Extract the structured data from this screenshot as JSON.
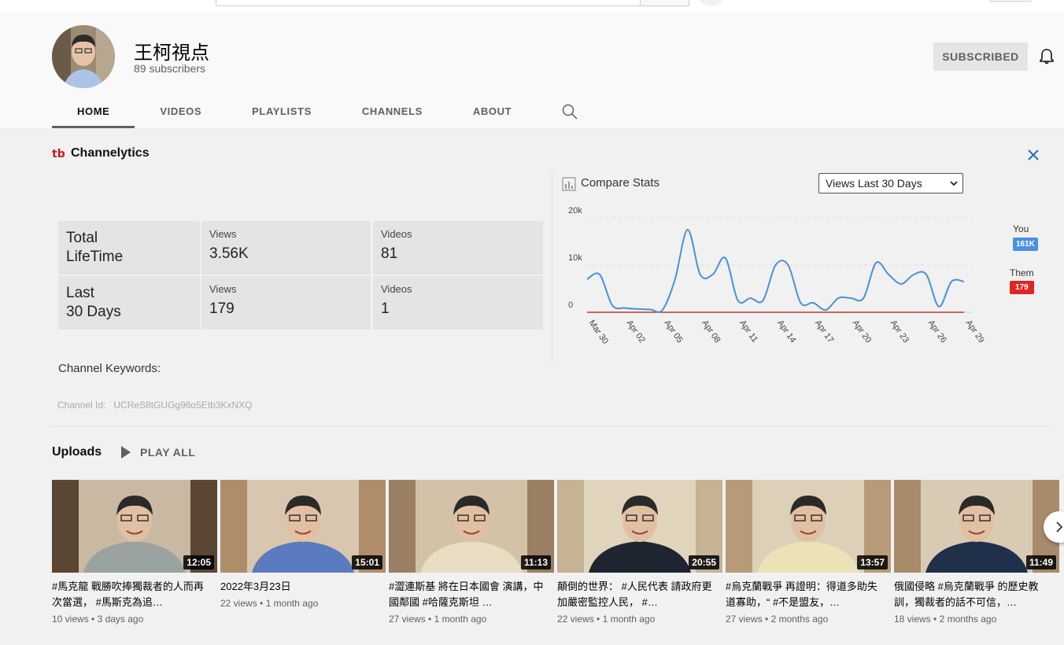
{
  "channel": {
    "name": "王柯視点",
    "subscribers": "89 subscribers",
    "subscribe_label": "SUBSCRIBED"
  },
  "tabs": [
    {
      "label": "HOME",
      "active": true
    },
    {
      "label": "VIDEOS",
      "active": false
    },
    {
      "label": "PLAYLISTS",
      "active": false
    },
    {
      "label": "CHANNELS",
      "active": false
    },
    {
      "label": "ABOUT",
      "active": false
    }
  ],
  "channelytics": {
    "logo_text": "tb",
    "title": "Channelytics",
    "stats": {
      "lifetime": {
        "title_line1": "Total",
        "title_line2": "LifeTime",
        "views_label": "Views",
        "views": "3.56K",
        "videos_label": "Videos",
        "videos": "81"
      },
      "last30": {
        "title_line1": "Last",
        "title_line2": "30 Days",
        "views_label": "Views",
        "views": "179",
        "videos_label": "Videos",
        "videos": "1"
      }
    },
    "keywords_label": "Channel Keywords:",
    "channel_id_label": "Channel Id:",
    "channel_id": "UCReS8tGUGg96o5Etb3KxNXQ",
    "compare_title": "Compare Stats",
    "period_selected": "Views Last 30 Days",
    "legend": {
      "you_label": "You",
      "you_value": "161K",
      "them_label": "Them",
      "them_value": "179"
    }
  },
  "chart_data": {
    "type": "line",
    "y_ticks": [
      "20k",
      "10k",
      "0"
    ],
    "ylim": [
      0,
      20000
    ],
    "x_tick_labels": [
      "Mar 30",
      "Apr 02",
      "Apr 05",
      "Apr 08",
      "Apr 11",
      "Apr 14",
      "Apr 17",
      "Apr 20",
      "Apr 23",
      "Apr 26",
      "Apr 29"
    ],
    "x": [
      "Mar 30",
      "Mar 31",
      "Apr 01",
      "Apr 02",
      "Apr 03",
      "Apr 04",
      "Apr 05",
      "Apr 06",
      "Apr 07",
      "Apr 08",
      "Apr 09",
      "Apr 10",
      "Apr 11",
      "Apr 12",
      "Apr 13",
      "Apr 14",
      "Apr 15",
      "Apr 16",
      "Apr 17",
      "Apr 18",
      "Apr 19",
      "Apr 20",
      "Apr 21",
      "Apr 22",
      "Apr 23",
      "Apr 24",
      "Apr 25",
      "Apr 26",
      "Apr 27",
      "Apr 28",
      "Apr 29"
    ],
    "series": [
      {
        "name": "You",
        "color": "#4a90d9",
        "values": [
          7000,
          8000,
          1500,
          900,
          700,
          600,
          500,
          7000,
          17500,
          8000,
          8000,
          11500,
          2500,
          3000,
          2500,
          10000,
          10000,
          2000,
          2000,
          500,
          3000,
          3000,
          3000,
          10500,
          8000,
          6000,
          8000,
          8000,
          1200,
          6500,
          6500
        ]
      },
      {
        "name": "Them",
        "color": "#c0392b",
        "values": [
          0,
          0,
          0,
          0,
          0,
          0,
          0,
          0,
          0,
          0,
          0,
          0,
          0,
          0,
          0,
          0,
          0,
          0,
          0,
          0,
          0,
          0,
          0,
          0,
          0,
          0,
          0,
          0,
          0,
          0,
          0
        ]
      }
    ]
  },
  "uploads": {
    "title": "Uploads",
    "play_all": "PLAY ALL",
    "videos": [
      {
        "title": "#馬克龍 戰勝吹捧獨裁者的人而再次當選， #馬斯克為追…",
        "duration": "12:05",
        "views": "10 views",
        "age": "3 days ago"
      },
      {
        "title": "2022年3月23日",
        "duration": "15:01",
        "views": "22 views",
        "age": "1 month ago"
      },
      {
        "title": "#澀連斯基 將在日本國會 演講，中國鄰國 #哈薩克斯坦 …",
        "duration": "11:13",
        "views": "27 views",
        "age": "1 month ago"
      },
      {
        "title": "顛倒的世界： #人民代表 請政府更加嚴密監控人民， #…",
        "duration": "20:55",
        "views": "22 views",
        "age": "1 month ago"
      },
      {
        "title": "#烏克蘭戰爭 再證明：得道多助失道寡助，“ #不是盟友，…",
        "duration": "13:57",
        "views": "27 views",
        "age": "2 months ago"
      },
      {
        "title": "俄國侵略 #烏克蘭戰爭 的歷史教訓，獨裁者的話不可信，…",
        "duration": "11:49",
        "views": "18 views",
        "age": "2 months ago"
      }
    ]
  }
}
